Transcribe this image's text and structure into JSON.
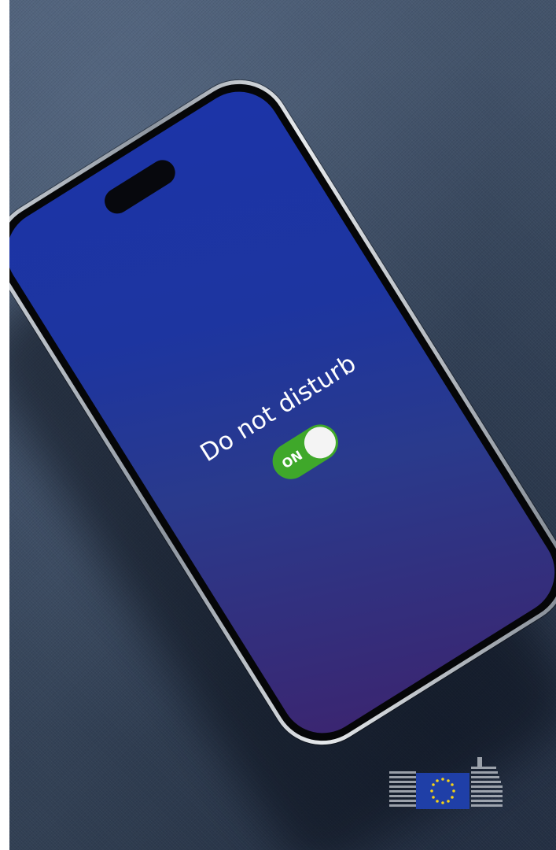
{
  "screen": {
    "title": "Do not disturb",
    "toggle": {
      "label": "ON",
      "state": "on",
      "color": "#3fa82a"
    }
  },
  "colors": {
    "screen_top": "#1c34a8",
    "screen_bottom": "#3b2570",
    "fabric": "#3a4a60"
  },
  "logo": {
    "name": "european-commission-logo-icon"
  }
}
